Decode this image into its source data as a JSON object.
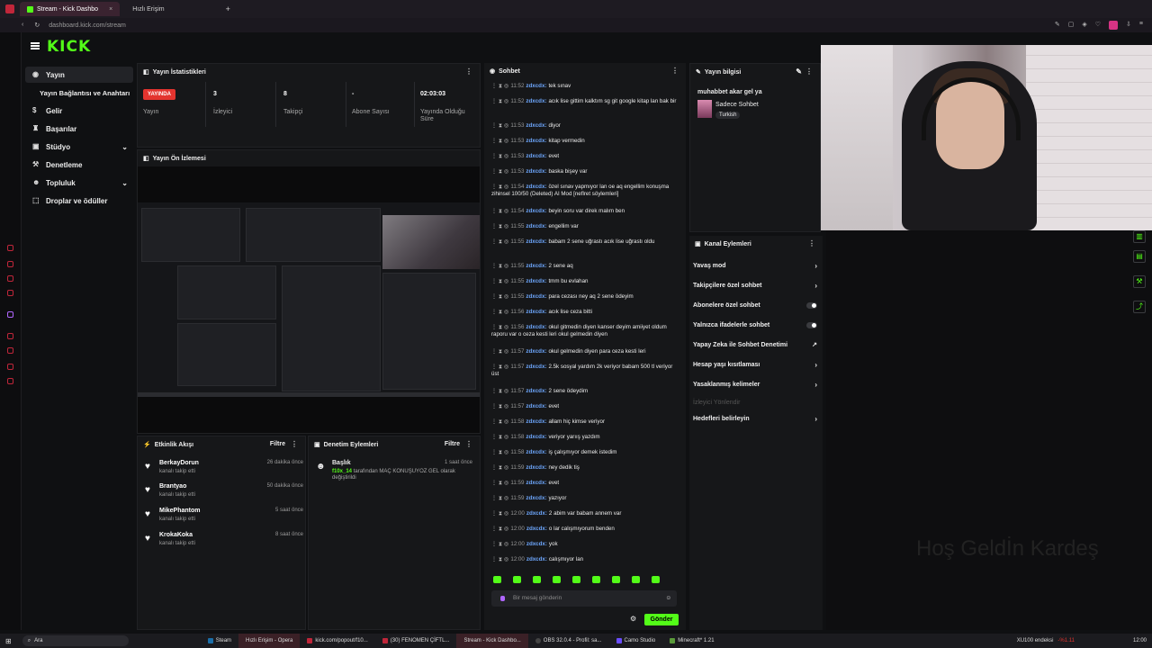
{
  "browser": {
    "tabs": [
      {
        "label": "Stream - Kick Dashbo",
        "active": true
      },
      {
        "label": "Hızlı Erişim",
        "active": false
      }
    ],
    "url": "dashboard.kick.com/stream"
  },
  "logo": "KICK",
  "sidebar": {
    "items": [
      {
        "label": "Yayın",
        "icon": "broadcast-icon",
        "active": true
      },
      {
        "label": "Yayın Bağlantısı ve Anahtarı",
        "icon": "",
        "active": false
      },
      {
        "label": "Gelir",
        "icon": "money-icon",
        "active": false
      },
      {
        "label": "Başarılar",
        "icon": "trophy-icon",
        "active": false
      },
      {
        "label": "Stüdyo",
        "icon": "studio-icon",
        "active": false,
        "chevron": true
      },
      {
        "label": "Denetleme",
        "icon": "gavel-icon",
        "active": false
      },
      {
        "label": "Topluluk",
        "icon": "community-icon",
        "active": false,
        "chevron": true
      },
      {
        "label": "Droplar ve ödüller",
        "icon": "gift-icon",
        "active": false
      }
    ]
  },
  "stats": {
    "title": "Yayın İstatistikleri",
    "live_badge": "YAYINDA",
    "items": [
      {
        "value": "",
        "label": "Yayın"
      },
      {
        "value": "3",
        "label": "İzleyici"
      },
      {
        "value": "8",
        "label": "Takipçi"
      },
      {
        "value": "-",
        "label": "Abone Sayısı"
      },
      {
        "value": "02:03:03",
        "label": "Yayında Olduğu Süre"
      }
    ]
  },
  "preview": {
    "title": "Yayın Ön İzlemesi"
  },
  "activity": {
    "title": "Etkinlik Akışı",
    "filter": "Filtre",
    "rows": [
      {
        "name": "BerkayDorun",
        "sub": "kanalı takip etti",
        "time": "26 dakika önce"
      },
      {
        "name": "Brantyao",
        "sub": "kanalı takip etti",
        "time": "50 dakika önce"
      },
      {
        "name": "MikePhantom",
        "sub": "kanalı takip etti",
        "time": "5 saat önce"
      },
      {
        "name": "KrokaKoka",
        "sub": "kanalı takip etti",
        "time": "8 saat önce"
      }
    ]
  },
  "moderation": {
    "title": "Denetim Eylemleri",
    "filter": "Filtre",
    "row": {
      "title": "Başlık",
      "time": "1 saat önce",
      "actor": "f10x_14",
      "text": "tarafından MAÇ KONUŞUYOZ GEL olarak değiştirildi"
    }
  },
  "chat": {
    "title": "Sohbet",
    "messages": [
      {
        "time": "11:52",
        "user": "zdxcdx:",
        "text": "tek sınav"
      },
      {
        "time": "11:52",
        "user": "zdxcdx:",
        "text": "acık lise gittim kalktım sg git google kitap lan bak bir"
      },
      {
        "time": "11:53",
        "user": "zdxcdx:",
        "text": "diyor"
      },
      {
        "time": "11:53",
        "user": "zdxcdx:",
        "text": "kitap vermedin"
      },
      {
        "time": "11:53",
        "user": "zdxcdx:",
        "text": "evet"
      },
      {
        "time": "11:53",
        "user": "zdxcdx:",
        "text": "baska bişey var"
      },
      {
        "time": "11:54",
        "user": "zdxcdx:",
        "text": "özel sınav yapmıyor lan oe aq engellim konuşma zihinsel 100/50 (Deleted) AI Mod [neflret söylemleri]"
      },
      {
        "time": "11:54",
        "user": "zdxcdx:",
        "text": "beyin soru var direk malım ben"
      },
      {
        "time": "11:55",
        "user": "zdxcdx:",
        "text": "engellim var"
      },
      {
        "time": "11:55",
        "user": "zdxcdx:",
        "text": "babam 2 sene uğrastı acık lise uğrastı oldu"
      },
      {
        "time": "11:55",
        "user": "zdxcdx:",
        "text": "2 sene aq"
      },
      {
        "time": "11:55",
        "user": "zdxcdx:",
        "text": "tmm bu evlahan"
      },
      {
        "time": "11:55",
        "user": "zdxcdx:",
        "text": "para cezası ney aq 2 sene ödeyim"
      },
      {
        "time": "11:56",
        "user": "zdxcdx:",
        "text": "acık lise ceza bitti"
      },
      {
        "time": "11:56",
        "user": "zdxcdx:",
        "text": "okul gitmedin diyen kanser deyim amiiyet oldum raporu var o ceza kesti leri okul gelmedin diyen"
      },
      {
        "time": "11:57",
        "user": "zdxcdx:",
        "text": "okul gelmedin diyen para ceza kesti leri"
      },
      {
        "time": "11:57",
        "user": "zdxcdx:",
        "text": "2.5k sosyal yardım 2k veriyor babam 500 tl veriyor üst"
      },
      {
        "time": "11:57",
        "user": "zdxcdx:",
        "text": "2 sene ödeydim"
      },
      {
        "time": "11:57",
        "user": "zdxcdx:",
        "text": "evet"
      },
      {
        "time": "11:58",
        "user": "zdxcdx:",
        "text": "allam hiç kimse veriyor"
      },
      {
        "time": "11:58",
        "user": "zdxcdx:",
        "text": "veriyor yarıış yazdım"
      },
      {
        "time": "11:58",
        "user": "zdxcdx:",
        "text": "iş çalışmıyor demek istedim"
      },
      {
        "time": "11:59",
        "user": "zdxcdx:",
        "text": "ney dedik tiş"
      },
      {
        "time": "11:59",
        "user": "zdxcdx:",
        "text": "evet"
      },
      {
        "time": "11:59",
        "user": "zdxcdx:",
        "text": "yazıyor"
      },
      {
        "time": "12:00",
        "user": "zdxcdx:",
        "text": "2 abim var babam annem var"
      },
      {
        "time": "12:00",
        "user": "zdxcdx:",
        "text": "o lar calışmıyorum benden"
      },
      {
        "time": "12:00",
        "user": "zdxcdx:",
        "text": "yok"
      },
      {
        "time": "12:00",
        "user": "zdxcdx:",
        "text": "calışmıyor lan"
      }
    ],
    "input_placeholder": "Bir mesaj gönderin",
    "send_label": "Gönder"
  },
  "stream_info": {
    "title": "Yayın bilgisi",
    "stream_title": "muhabbet akar gel ya",
    "category": "Sadece Sohbet",
    "language": "Turkish"
  },
  "channel_actions": {
    "title": "Kanal Eylemleri",
    "items": [
      {
        "label": "Yavaş mod",
        "control": "chevron"
      },
      {
        "label": "Takipçilere özel sohbet",
        "control": "chevron"
      },
      {
        "label": "Abonelere özel sohbet",
        "control": "toggle"
      },
      {
        "label": "Yalnızca ifadelerle sohbet",
        "control": "toggle"
      },
      {
        "label": "Yapay Zeka ile Sohbet Denetimi",
        "control": "external"
      },
      {
        "label": "Hesap yaşı kısıtlaması",
        "control": "chevron"
      },
      {
        "label": "Yasaklanmış kelimeler",
        "control": "chevron"
      },
      {
        "label": "İzleyici Yönlendir",
        "control": "none",
        "muted": true
      },
      {
        "label": "Hedefleri belirleyin",
        "control": "chevron"
      }
    ]
  },
  "overlay": {
    "text": "Hoş Geldİn Kardeş"
  },
  "taskbar": {
    "search": "Ara",
    "items": [
      "Steam",
      "Hızlı Erişim - Opera",
      "kick.com/popout/f10...",
      "(30) FENOMEN ÇİFTL...",
      "Stream - Kick Dashbo...",
      "OBS 32.0.4 - Profil: sa...",
      "Camo Studio",
      "Minecraft* 1.21"
    ],
    "right": [
      "XU100 endeksi",
      "-%1.11",
      "12:00"
    ]
  }
}
